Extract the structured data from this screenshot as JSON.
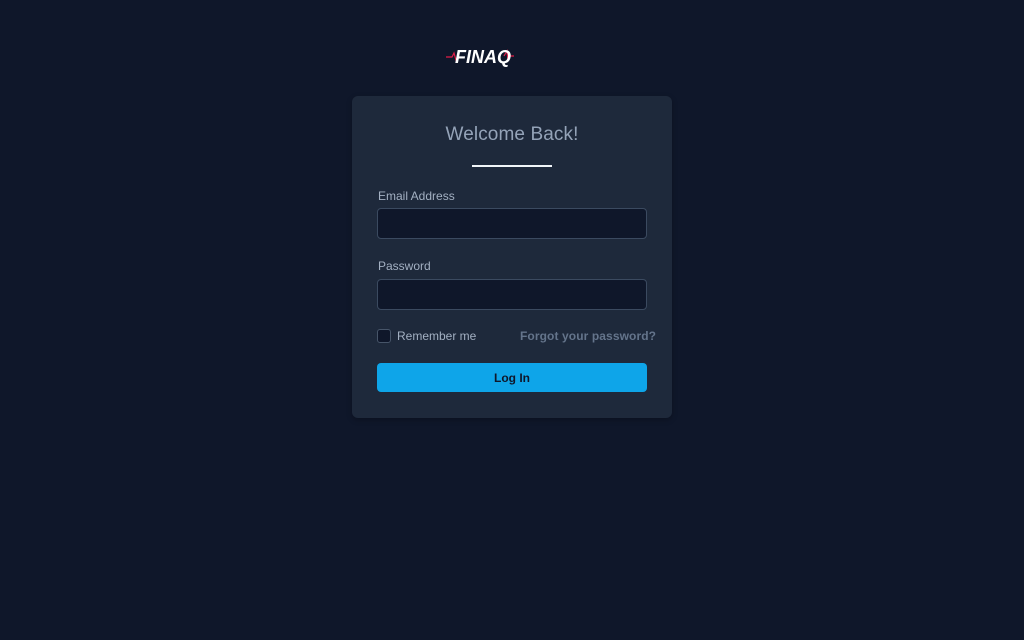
{
  "brand": {
    "logo_text": "FINAQ",
    "accent_color": "#e11d48",
    "text_color": "#ffffff"
  },
  "login_card": {
    "title": "Welcome Back!",
    "email": {
      "label": "Email Address",
      "value": "",
      "placeholder": ""
    },
    "password": {
      "label": "Password",
      "value": "",
      "placeholder": ""
    },
    "remember_me_label": "Remember me",
    "remember_me_checked": false,
    "forgot_password_label": "Forgot your password?",
    "login_button_label": "Log In"
  },
  "colors": {
    "background": "#0f172a",
    "card": "#1e293b",
    "primary": "#0ea5e9"
  }
}
